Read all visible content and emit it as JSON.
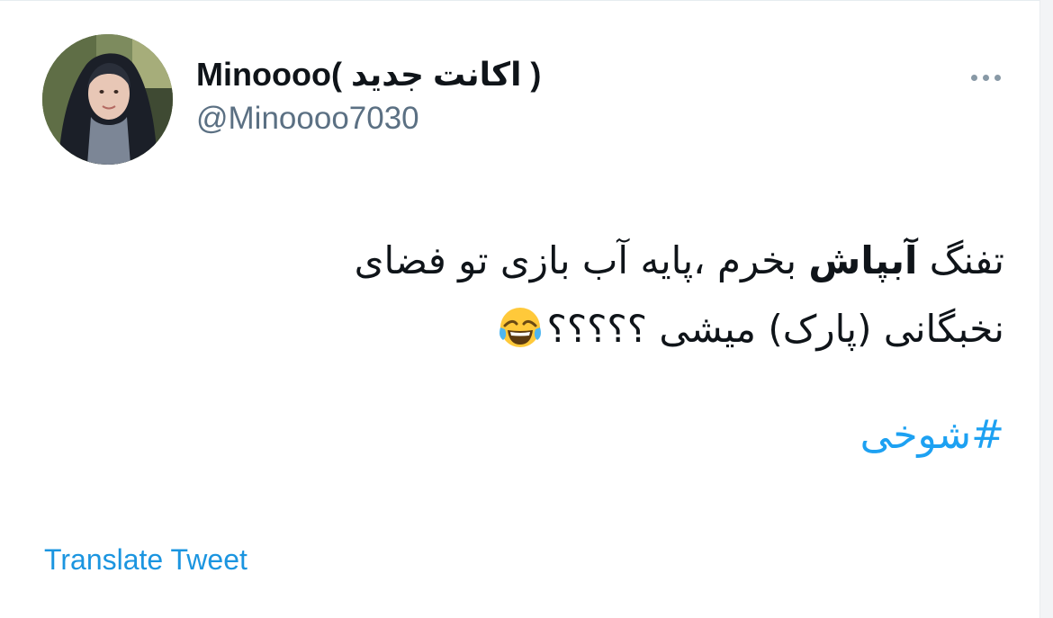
{
  "tweet": {
    "author": {
      "display_name": "Minoooo( اکانت جدید )",
      "handle": "@Minoooo7030",
      "avatar_icon": "profile-photo"
    },
    "more_icon": "more-horizontal-icon",
    "body": {
      "line1_start": "تفنگ ",
      "line1_bold": "آبپاش",
      "line1_end": " بخرم ،پایه آب بازی تو فضای",
      "line2": "نخبگانی (پارک) میشی ؟؟؟؟؟",
      "emoji": "face-with-tears-of-joy"
    },
    "hashtag": "#شوخی",
    "translate_label": "Translate Tweet"
  },
  "colors": {
    "text_primary": "#0f1419",
    "text_secondary": "#5b7083",
    "link": "#1da1f2",
    "translate_link": "#1b95e0"
  }
}
